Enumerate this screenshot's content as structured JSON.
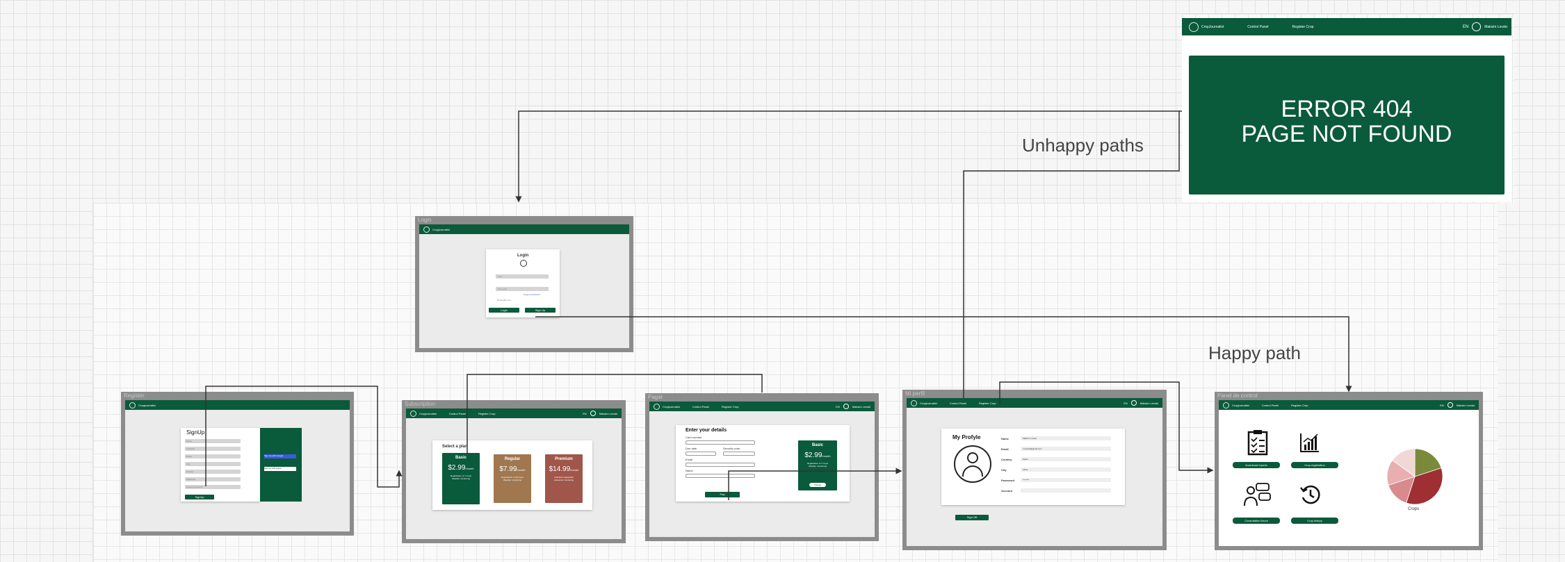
{
  "labels": {
    "unhappy": "Unhappy paths",
    "happy": "Happy path"
  },
  "colors": {
    "brand": "#0a5a3c",
    "frame": "#8c8c8c",
    "regular": "#a0774f",
    "premium": "#a0564a"
  },
  "error_page": {
    "nav": {
      "logo": "CropJournalist",
      "link1": "Control Panel",
      "link2": "Register Crop",
      "lang": "EN",
      "user": "Maksim Levski"
    },
    "title_line1": "ERROR 404",
    "title_line2": "PAGE NOT FOUND"
  },
  "login": {
    "frame_label": "Login",
    "nav_logo": "Cropjournalist",
    "title": "Login",
    "user_placeholder": "User",
    "password_placeholder": "Password",
    "forgot": "Forgot password?",
    "remember": "Remember me",
    "login_btn": "Login",
    "signup_btn": "Sign Up"
  },
  "register": {
    "frame_label": "Register",
    "nav_logo": "Cropjournalist",
    "title": "SignUp",
    "fields": [
      "Name",
      "Surname",
      "Email",
      "City",
      "Country",
      "Password",
      "Repeat password"
    ],
    "signup_btn": "SignUp",
    "google": "Sign Up with Google",
    "apple": "Sign up with Apple"
  },
  "subscription": {
    "frame_label": "Subscription",
    "nav": {
      "logo": "Cropjournalist",
      "link1": "Control Panel",
      "link2": "Register Crop",
      "lang": "EN",
      "user": "Maksim Levski"
    },
    "heading": "Select a plan",
    "plans": [
      {
        "name": "Basic",
        "price": "$2.99",
        "period": "/month",
        "features": [
          "Registration of 7 crops",
          "Weather monitoring"
        ]
      },
      {
        "name": "Regular",
        "price": "$7.99",
        "period": "/month",
        "features": [
          "Registration of 20 crops",
          "Weather monitoring"
        ]
      },
      {
        "name": "Premium",
        "price": "$14.99",
        "period": "/month",
        "features": [
          "Unlimited registration",
          "Advanced monitoring"
        ]
      }
    ]
  },
  "payment": {
    "frame_label": "Pagar",
    "nav": {
      "logo": "Cropjournalist",
      "link1": "Control Panel",
      "link2": "Register Crop",
      "lang": "EN",
      "user": "Maksim Levski"
    },
    "heading": "Enter your details",
    "labels": [
      "Card number",
      "Due date",
      "Security code",
      "Email",
      "Name"
    ],
    "pay_btn": "Pay",
    "plan": {
      "name": "Basic",
      "price": "$2.99",
      "period": "/month",
      "features": [
        "Registration of 7 crops",
        "Weather monitoring"
      ],
      "btn": "Change"
    }
  },
  "profile": {
    "frame_label": "Mi perfil",
    "nav": {
      "logo": "Cropjournalist",
      "link1": "Control Panel",
      "link2": "Register Crop",
      "lang": "EN",
      "user": "Maksim Levski"
    },
    "title": "My Profyle",
    "fields": [
      {
        "label": "Name",
        "value": "Maksim Levski"
      },
      {
        "label": "Email",
        "value": "m.levski@gmail.com"
      },
      {
        "label": "Country",
        "value": "Spain"
      },
      {
        "label": "City",
        "value": "Alicia"
      },
      {
        "label": "Password",
        "value": "********"
      },
      {
        "label": "Account",
        "value": ""
      }
    ],
    "signoff_btn": "Sign Off"
  },
  "control_panel": {
    "frame_label": "Panel de control",
    "nav": {
      "logo": "Cropjournalist",
      "link1": "Control Panel",
      "link2": "Register Crop",
      "lang": "EN",
      "user": "Maksim Levski"
    },
    "buttons": [
      "Download reports",
      "Crop registration",
      "Consultation forum",
      "Crop history"
    ],
    "chart_caption": "Crops",
    "chart_data": {
      "type": "pie",
      "values": [
        20,
        35,
        15,
        15,
        15
      ],
      "colors": [
        "#7a8a3a",
        "#9e2f32",
        "#d98a8e",
        "#e8aeb0",
        "#f2d7d7"
      ]
    }
  }
}
